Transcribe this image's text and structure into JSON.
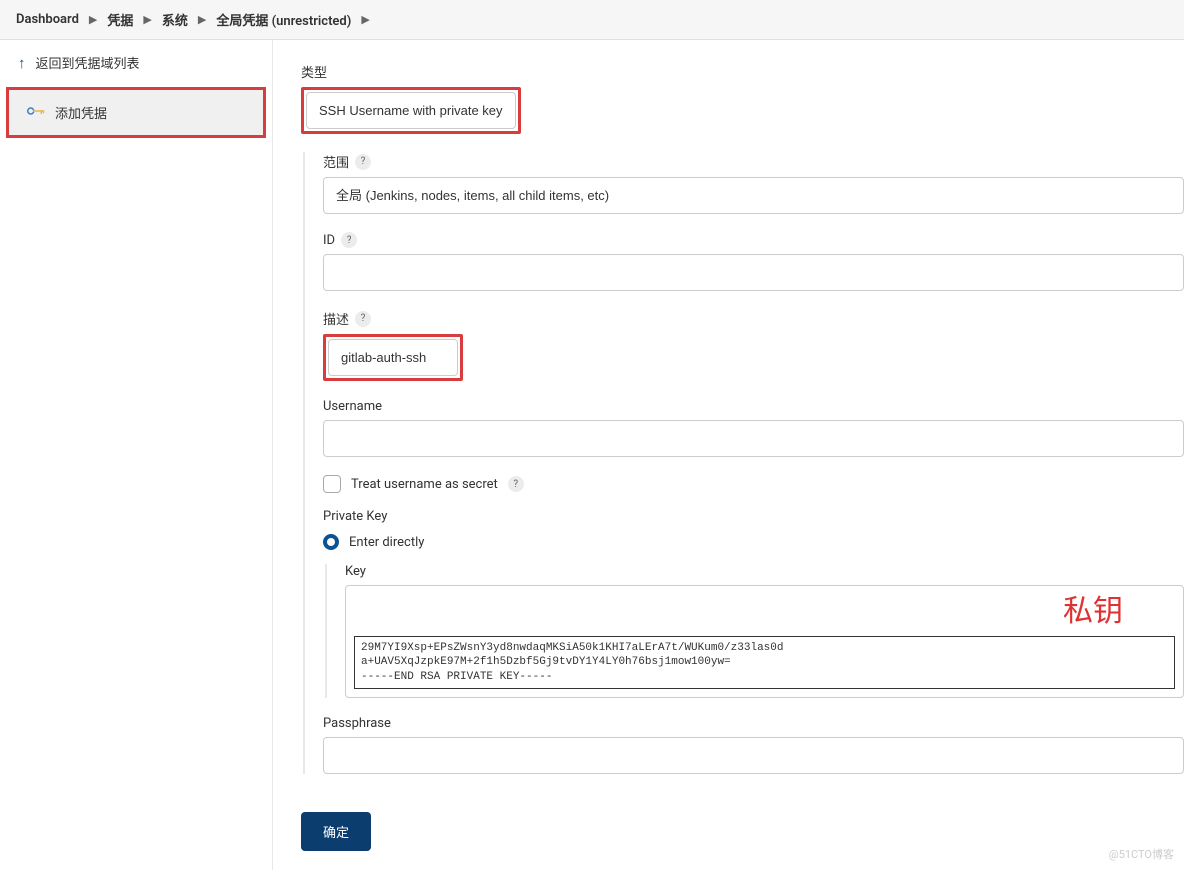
{
  "breadcrumb": {
    "items": [
      "Dashboard",
      "凭据",
      "系统",
      "全局凭据 (unrestricted)"
    ]
  },
  "sidebar": {
    "back": "返回到凭据域列表",
    "add": "添加凭据"
  },
  "form": {
    "type_label": "类型",
    "type_value": "SSH Username with private key",
    "scope_label": "范围",
    "scope_value": "全局 (Jenkins, nodes, items, all child items, etc)",
    "id_label": "ID",
    "id_value": "",
    "desc_label": "描述",
    "desc_value": "gitlab-auth-ssh",
    "username_label": "Username",
    "username_value": "",
    "treat_secret_label": "Treat username as secret",
    "private_key_label": "Private Key",
    "enter_directly_label": "Enter directly",
    "key_label": "Key",
    "key_text": "29M7YI9Xsp+EPsZWsnY3yd8nwdaqMKSiA50k1KHI7aLErA7t/WUKum0/z33las0d\na+UAV5XqJzpkE97M+2f1h5Dzbf5Gj9tvDY1Y4LY0h76bsj1mow100yw=\n-----END RSA PRIVATE KEY-----",
    "passphrase_label": "Passphrase",
    "passphrase_value": "",
    "submit_label": "确定"
  },
  "annotation": "私钥",
  "watermark": "@51CTO博客"
}
